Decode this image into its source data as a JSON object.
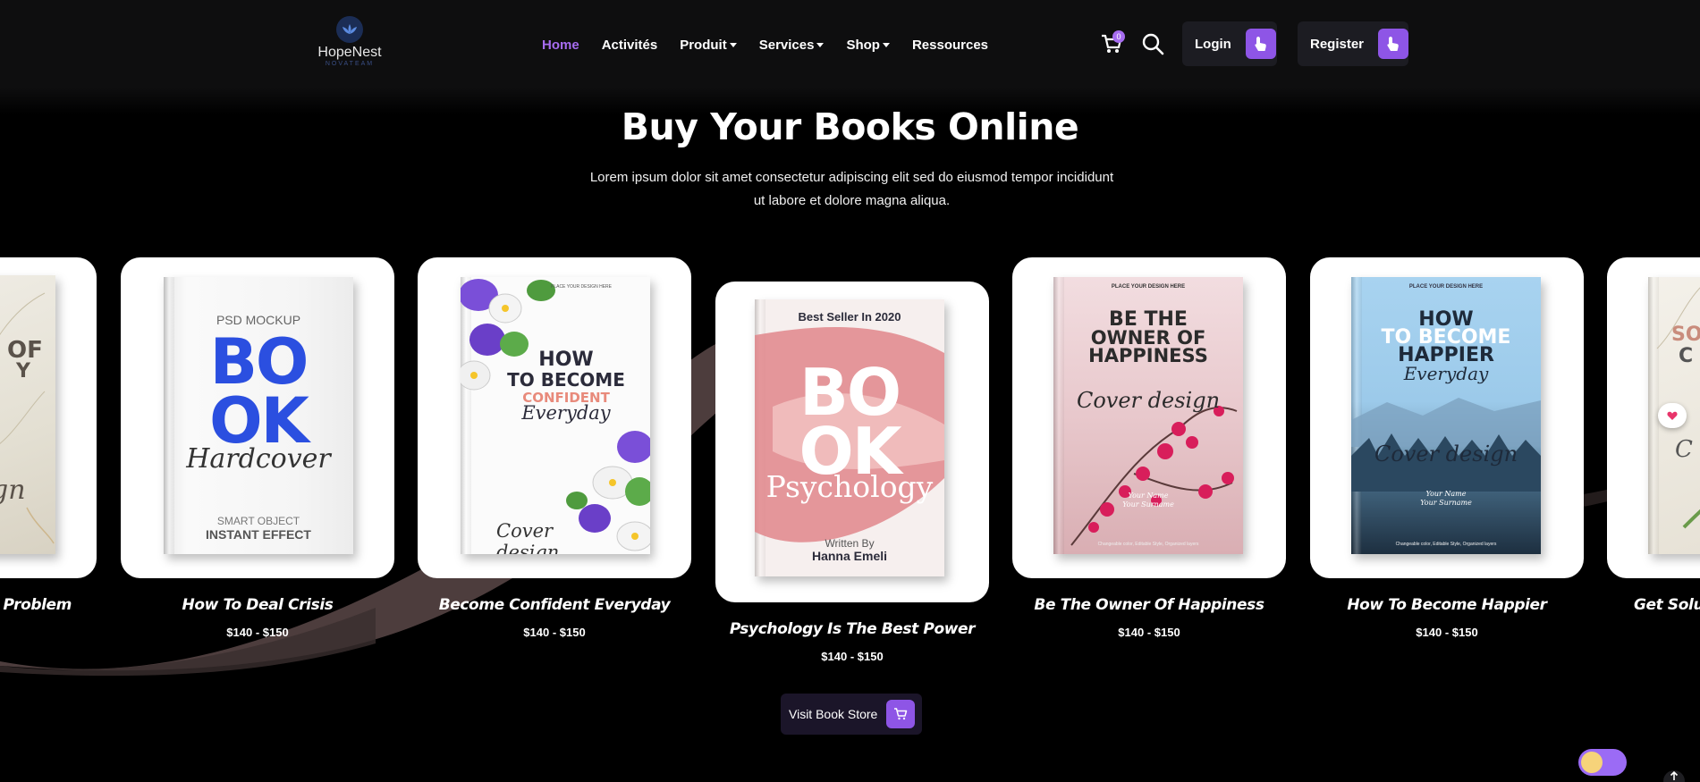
{
  "brand": {
    "name": "HopeNest",
    "tagline": "NOVATEAM",
    "logo_icon": "lotus-icon"
  },
  "nav": {
    "items": [
      {
        "label": "Home",
        "active": true,
        "dropdown": false
      },
      {
        "label": "Activités",
        "active": false,
        "dropdown": false
      },
      {
        "label": "Produit",
        "active": false,
        "dropdown": true
      },
      {
        "label": "Services",
        "active": false,
        "dropdown": true
      },
      {
        "label": "Shop",
        "active": false,
        "dropdown": true
      },
      {
        "label": "Ressources",
        "active": false,
        "dropdown": false
      }
    ],
    "cart_count": "0",
    "login_label": "Login",
    "register_label": "Register"
  },
  "hero": {
    "title": "Buy Your Books Online",
    "subtitle": "Lorem ipsum dolor sit amet consectetur adipiscing elit sed do eiusmod tempor incididunt ut labore et dolore magna aliqua."
  },
  "books": [
    {
      "name": "y Problem",
      "price": "",
      "cover": {
        "lines": [
          "OF",
          "Y",
          "gn"
        ]
      }
    },
    {
      "name": "How To Deal Crisis",
      "price": "$140 - $150",
      "cover": {
        "top": "PSD MOCKUP",
        "big1": "BO",
        "big2": "OK",
        "script": "Hardcover",
        "bottom1": "SMART OBJECT",
        "bottom2": "INSTANT EFFECT"
      }
    },
    {
      "name": "Become Confident Everyday",
      "price": "$140 - $150",
      "cover": {
        "top": "PLACE YOUR DESIGN HERE",
        "l1": "HOW",
        "l2": "TO BECOME",
        "l3": "CONFIDENT",
        "script": "Everyday",
        "bottom": "Cover design"
      }
    },
    {
      "name": "Psychology Is The Best Power",
      "price": "$140 - $150",
      "cover": {
        "top": "Best Seller In 2020",
        "big1": "BO",
        "big2": "OK",
        "script": "Psychology",
        "by": "Written By",
        "author": "Hanna Emeli"
      }
    },
    {
      "name": "Be The Owner Of Happiness",
      "price": "$140 - $150",
      "cover": {
        "top": "PLACE YOUR DESIGN HERE",
        "l1": "BE THE",
        "l2": "OWNER OF",
        "l3": "HAPPINESS",
        "script": "Cover design",
        "name1": "Your Name",
        "name2": "Your Surname",
        "footer": "Changeable color, Editable Style, Organized layers"
      }
    },
    {
      "name": "How To Become Happier",
      "price": "$140 - $150",
      "cover": {
        "top": "PLACE YOUR DESIGN HERE",
        "l1": "HOW",
        "l2": "TO BECOME",
        "l3": "HAPPIER",
        "script": "Everyday",
        "script2": "Cover design",
        "name1": "Your Name",
        "name2": "Your Surname",
        "footer": "Changeable color, Editable Style, Organized layers"
      }
    },
    {
      "name": "Get Solut",
      "price": "",
      "cover": {
        "l1": "SO",
        "l2": "C",
        "script": "C"
      }
    }
  ],
  "store_button": {
    "label": "Visit Book Store"
  },
  "colors": {
    "accent": "#a66cf0",
    "button_accent": "#8e55e6",
    "background": "#000000",
    "nav_bg": "#0e0e0f"
  }
}
